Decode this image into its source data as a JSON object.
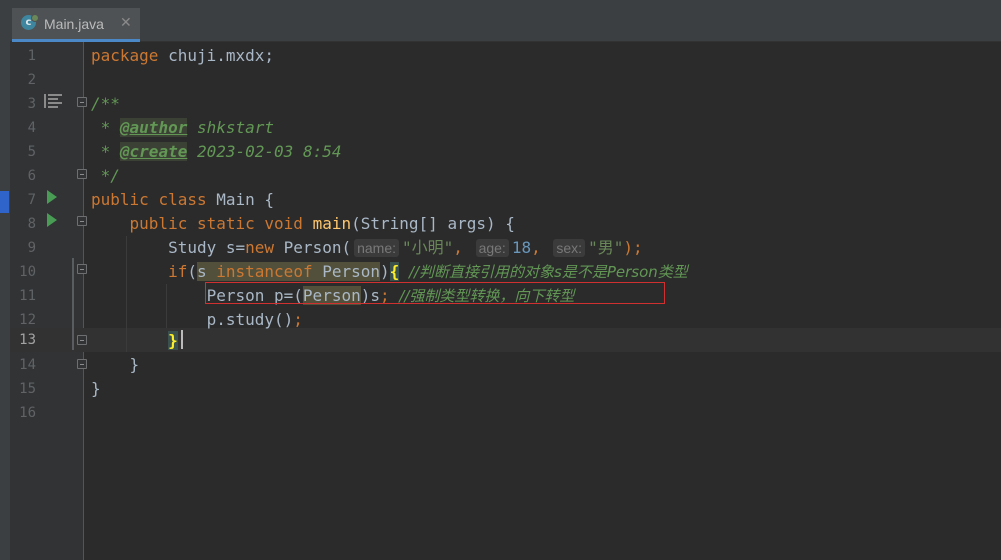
{
  "tab": {
    "title": "Main.java",
    "icon": "java-class-icon",
    "icon_letter": "c",
    "close_glyph": "✕"
  },
  "gutter": {
    "line_numbers": [
      "1",
      "2",
      "3",
      "4",
      "5",
      "6",
      "7",
      "8",
      "9",
      "10",
      "11",
      "12",
      "13",
      "14",
      "15",
      "16"
    ],
    "current_line": "13"
  },
  "code": {
    "l1": {
      "kw": "package",
      "rest": " chuji.mxdx;"
    },
    "l3": "/**",
    "l4": {
      "prefix": " * ",
      "tag": "@author",
      "rest": " shkstart"
    },
    "l5": {
      "prefix": " * ",
      "tag": "@create",
      "rest": " 2023-02-03 8:54"
    },
    "l6": " */",
    "l7": {
      "kw1": "public",
      "kw2": "class",
      "rest": " Main {"
    },
    "l8": {
      "kw1": "public",
      "kw2": "static",
      "kw3": "void",
      "fn": "main",
      "rest": "(String[] args) {"
    },
    "l9": {
      "a": "Study s=",
      "kw": "new",
      "b": " Person(",
      "hint1": "name:",
      "str1": "\"小明\"",
      "c1": ",",
      "hint2": "age:",
      "num": "18",
      "c2": ",",
      "hint3": "sex:",
      "str2": "\"男\"",
      "end": ");"
    },
    "l10": {
      "kw": "if",
      "open": "(",
      "var": "s",
      "kw2": "instanceof",
      "type": "Person",
      "close": ")",
      "brace": "{",
      "comment": "//判断直接引用的对象s是不是Person类型"
    },
    "l11": {
      "a": "Person p=(",
      "cast": "Person",
      "b": ")s",
      "semi": ";",
      "comment": "//强制类型转换，向下转型"
    },
    "l12": {
      "a": "p.study()",
      "semi": ";"
    },
    "l13": "}",
    "l14": "}",
    "l15": "}"
  }
}
